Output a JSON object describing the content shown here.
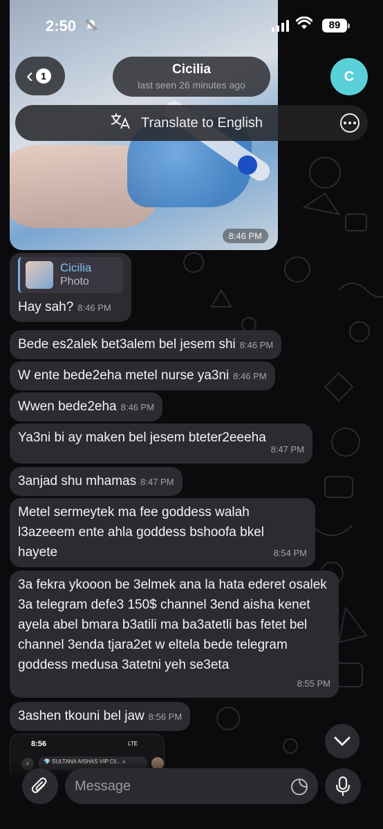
{
  "status_bar": {
    "time": "2:50",
    "battery": "89"
  },
  "header": {
    "back_count": "1",
    "contact_name": "Cicilia",
    "last_seen": "last seen 26 minutes ago",
    "avatar_initial": "C",
    "avatar_color": "#5ad1d8"
  },
  "translate_bar": {
    "label": "Translate to English",
    "icon": "translate-icon"
  },
  "photo": {
    "time": "8:46 PM"
  },
  "messages": [
    {
      "reply_name": "Cicilia",
      "reply_type": "Photo",
      "text": "Hay sah?",
      "time": "8:46 PM"
    },
    {
      "text": "Bede es2alek bet3alem bel jesem shi",
      "time": "8:46 PM"
    },
    {
      "text": "W ente bede2eha metel nurse ya3ni",
      "time": "8:46 PM"
    },
    {
      "text": "Wwen bede2eha",
      "time": "8:46 PM"
    },
    {
      "text": "Ya3ni bi ay maken bel jesem bteter2eeeha",
      "time": "8:47 PM"
    },
    {
      "text": "3anjad shu mhamas",
      "time": "8:47 PM"
    },
    {
      "text": "Metel sermeytek ma fee goddess walah l3azeeem ente ahla goddess bshoofa bkel hayete",
      "time": "8:54 PM"
    },
    {
      "text": "3a fekra ykooon be 3elmek ana la hata ederet osalek 3a telegram defe3 150$ channel 3end aisha kenet ayela abel bmara b3atili ma ba3atetli bas fetet bel channel 3enda tjara2et w eltela bede telegram goddess medusa 3atetni yeh se3eta",
      "time": "8:55 PM"
    },
    {
      "text": "3ashen tkouni bel jaw",
      "time": "8:56 PM"
    }
  ],
  "forwarded_screenshot": {
    "time": "8:56",
    "network": "LTE",
    "channel_name": "💎 SULTANA AISHAS VIP Cli... «"
  },
  "composer": {
    "placeholder": "Message"
  },
  "colors": {
    "bubble": "#2d2a30",
    "accent": "#6db3e6",
    "background": "#0b0b0d"
  }
}
